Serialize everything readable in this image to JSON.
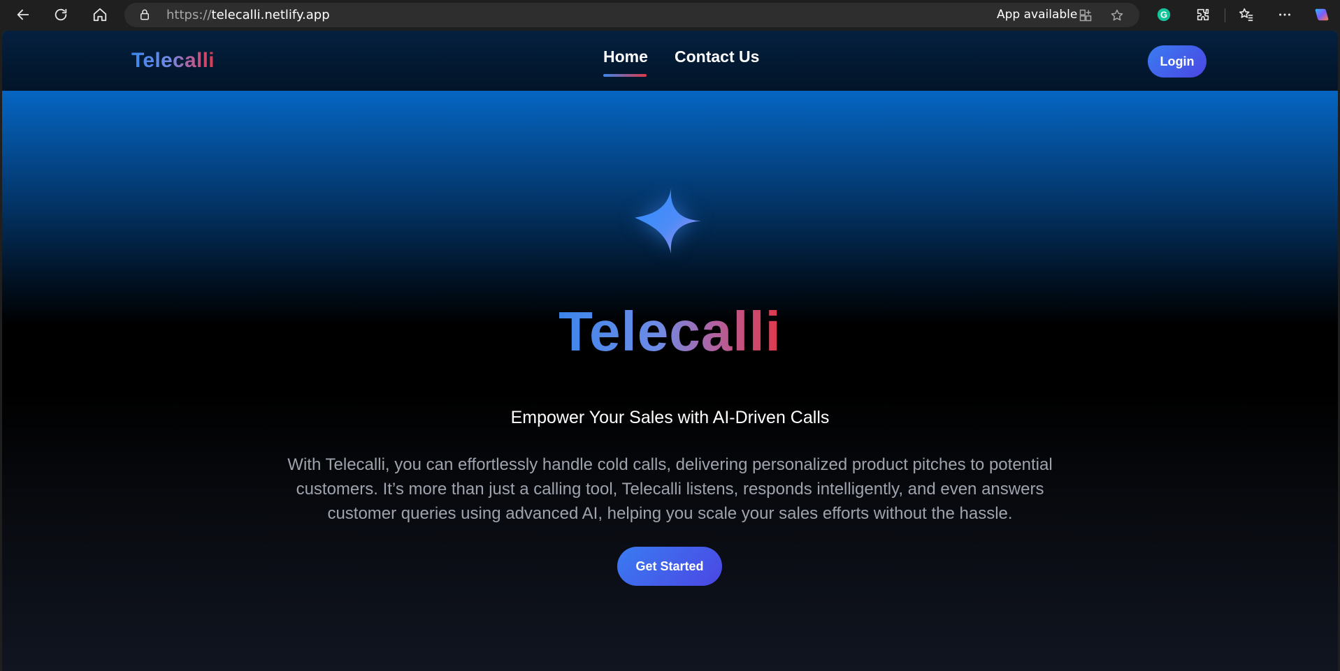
{
  "browser": {
    "url_protocol": "https://",
    "url_host": "telecalli.netlify.app",
    "app_available_label": "App available"
  },
  "nav": {
    "logo": "Telecalli",
    "links": [
      {
        "label": "Home",
        "active": true
      },
      {
        "label": "Contact Us",
        "active": false
      }
    ],
    "login_label": "Login"
  },
  "hero": {
    "title": "Telecalli",
    "tagline": "Empower Your Sales with AI-Driven Calls",
    "description": "With Telecalli, you can effortlessly handle cold calls, delivering personalized product pitches to potential customers. It’s more than just a calling tool, Telecalli listens, responds intelligently, and even answers customer queries using advanced AI, helping you scale your sales efforts without the hassle.",
    "cta_label": "Get Started"
  },
  "colors": {
    "brand_blue": "#3c86ec",
    "brand_red": "#e0384a",
    "button_start": "#3a7cf2",
    "button_end": "#4b46e3"
  },
  "icons": [
    "back-arrow-icon",
    "refresh-icon",
    "home-icon",
    "lock-icon",
    "app-install-icon",
    "favorite-star-icon",
    "grammarly-icon",
    "extensions-icon",
    "favorites-icon",
    "more-icon",
    "copilot-icon",
    "sparkle-star-icon"
  ]
}
